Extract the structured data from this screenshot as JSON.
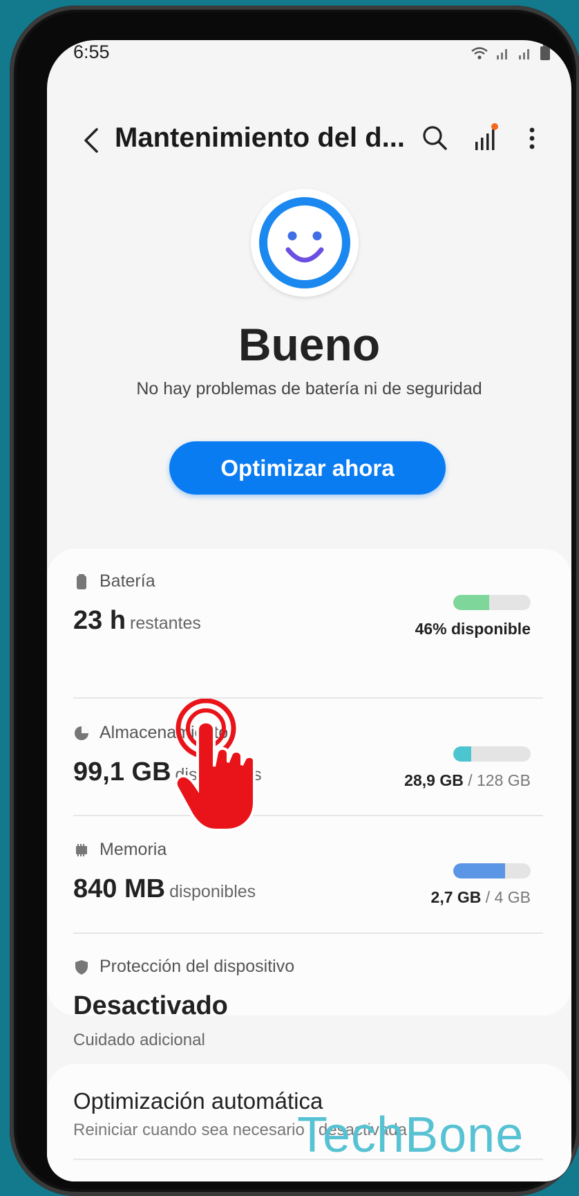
{
  "status_bar": {
    "time": "6:55"
  },
  "app_bar": {
    "title": "Mantenimiento del d..."
  },
  "status": {
    "label": "Bueno",
    "description": "No hay problemas de batería ni de seguridad"
  },
  "optimize_button": "Optimizar ahora",
  "items": [
    {
      "heading": "Batería",
      "value": "23 h",
      "unit": "restantes",
      "right_bold": "46% disponible",
      "right_rest": "",
      "level": 0.46,
      "color": "#7ed69b"
    },
    {
      "heading": "Almacenamiento",
      "value": "99,1 GB",
      "unit": "disponibles",
      "right_bold": "28,9 GB",
      "right_rest": " / 128 GB",
      "level": 0.23,
      "color": "#4bc5cf"
    },
    {
      "heading": "Memoria",
      "value": "840 MB",
      "unit": "disponibles",
      "right_bold": "2,7 GB",
      "right_rest": " / 4 GB",
      "level": 0.67,
      "color": "#5b95e6"
    },
    {
      "heading": "Protección del dispositivo",
      "value": "Desactivado"
    }
  ],
  "section_label": "Cuidado adicional",
  "auto_opt": {
    "title": "Optimización automática",
    "subtitle": "Reiniciar cuando sea necesario : desactivada"
  },
  "watermark": "TechBone",
  "colors": {
    "accent": "#0a7cf2",
    "face_ring": "#1a88ef",
    "smile": "#6c4fe0",
    "pointer": "#e8141a"
  },
  "icons": [
    "back-icon",
    "search-icon",
    "chart-icon",
    "more-icon",
    "smiley-icon",
    "battery-icon",
    "storage-icon",
    "memory-icon",
    "shield-icon",
    "tap-hand-icon"
  ]
}
